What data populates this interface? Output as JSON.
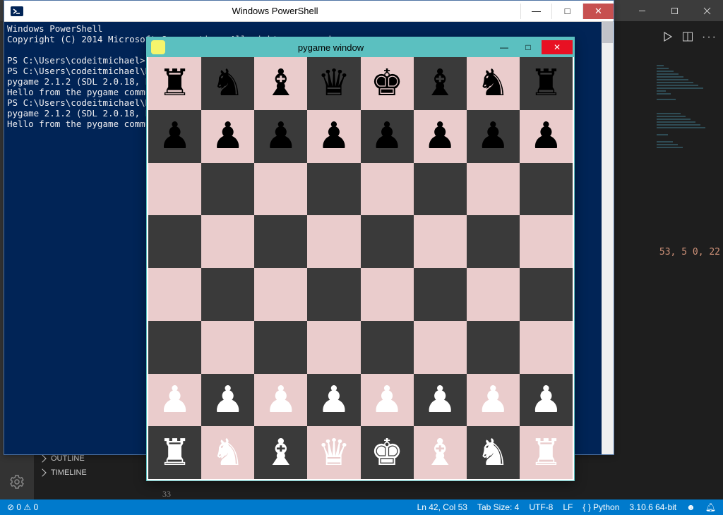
{
  "vscode": {
    "minimap_lines": [
      12,
      16,
      20,
      24,
      28,
      32,
      36,
      40,
      44,
      48,
      52,
      60,
      80,
      84,
      88,
      92,
      96,
      100,
      110,
      120,
      124,
      128
    ],
    "peek_text": "53, 5\n0, 22",
    "side_panel": {
      "outline": "OUTLINE",
      "timeline": "TIMELINE",
      "gutter_num": "33"
    },
    "statusbar": {
      "errors": "0",
      "warnings": "0",
      "pos": "Ln 42, Col 53",
      "tab": "Tab Size: 4",
      "enc": "UTF-8",
      "eol": "LF",
      "lang": "Python",
      "interp": "3.10.6 64-bit"
    }
  },
  "powershell": {
    "title": "Windows PowerShell",
    "lines": [
      "Windows PowerShell",
      "Copyright (C) 2014 Microsoft Corporation. All rights reserved.",
      "",
      "PS C:\\Users\\codeitmichael> c",
      "PS C:\\Users\\codeitmichael\\Do",
      "pygame 2.1.2 (SDL 2.0.18, Py",
      "Hello from the pygame commun",
      "PS C:\\Users\\codeitmichael\\Do",
      "pygame 2.1.2 (SDL 2.0.18, Py",
      "Hello from the pygame commun"
    ]
  },
  "pygame": {
    "title": "pygame window",
    "board": {
      "light": "#eacccc",
      "dark": "#3a3a3a",
      "rows": [
        [
          "br",
          "bn",
          "bb",
          "bq",
          "bk",
          "bb",
          "bn",
          "br"
        ],
        [
          "bp",
          "bp",
          "bp",
          "bp",
          "bp",
          "bp",
          "bp",
          "bp"
        ],
        [
          "",
          "",
          "",
          "",
          "",
          "",
          "",
          ""
        ],
        [
          "",
          "",
          "",
          "",
          "",
          "",
          "",
          ""
        ],
        [
          "",
          "",
          "",
          "",
          "",
          "",
          "",
          ""
        ],
        [
          "",
          "",
          "",
          "",
          "",
          "",
          "",
          ""
        ],
        [
          "wp",
          "wp",
          "wp",
          "wp",
          "wp",
          "wp",
          "wp",
          "wp"
        ],
        [
          "wr",
          "wn",
          "wb",
          "wq",
          "wk",
          "wb",
          "wn",
          "wr"
        ]
      ]
    }
  },
  "piece_glyphs": {
    "k": "♚",
    "q": "♛",
    "r": "♜",
    "b": "♝",
    "n": "♞",
    "p": "♟"
  }
}
